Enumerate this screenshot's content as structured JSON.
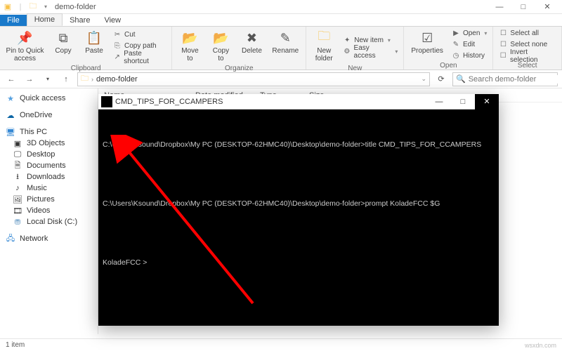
{
  "window": {
    "title": "demo-folder",
    "controls": {
      "min": "—",
      "max": "□",
      "close": "✕"
    }
  },
  "tabs": {
    "file": "File",
    "home": "Home",
    "share": "Share",
    "view": "View"
  },
  "ribbon": {
    "clipboard": {
      "caption": "Clipboard",
      "pin": "Pin to Quick\naccess",
      "copy": "Copy",
      "paste": "Paste",
      "cut": "Cut",
      "copy_path": "Copy path",
      "paste_shortcut": "Paste shortcut"
    },
    "organize": {
      "caption": "Organize",
      "move": "Move\nto",
      "copy_to": "Copy\nto",
      "delete": "Delete",
      "rename": "Rename"
    },
    "new": {
      "caption": "New",
      "new_folder": "New\nfolder",
      "new_item": "New item",
      "easy_access": "Easy access"
    },
    "open": {
      "caption": "Open",
      "properties": "Properties",
      "open": "Open",
      "edit": "Edit",
      "history": "History"
    },
    "select": {
      "caption": "Select",
      "select_all": "Select all",
      "select_none": "Select none",
      "invert": "Invert selection"
    }
  },
  "address": {
    "crumb": "demo-folder",
    "sep": "›",
    "search_placeholder": "Search demo-folder"
  },
  "columns": {
    "name": "Name",
    "date": "Date modified",
    "type": "Type",
    "size": "Size"
  },
  "sidebar": {
    "quick": "Quick access",
    "onedrive": "OneDrive",
    "thispc": "This PC",
    "items": [
      "3D Objects",
      "Desktop",
      "Documents",
      "Downloads",
      "Music",
      "Pictures",
      "Videos",
      "Local Disk (C:)"
    ],
    "network": "Network"
  },
  "status": {
    "count": "1 item",
    "watermark": "wsxdn.com"
  },
  "cmd": {
    "title": "CMD_TIPS_FOR_CCAMPERS",
    "controls": {
      "min": "—",
      "max": "□",
      "close": "✕"
    },
    "lines": [
      "C:\\Users\\Ksound\\Dropbox\\My PC (DESKTOP-62HMC40)\\Desktop\\demo-folder>title CMD_TIPS_FOR_CCAMPERS",
      "",
      "C:\\Users\\Ksound\\Dropbox\\My PC (DESKTOP-62HMC40)\\Desktop\\demo-folder>prompt KoladeFCC $G",
      "",
      "KoladeFCC >"
    ]
  }
}
